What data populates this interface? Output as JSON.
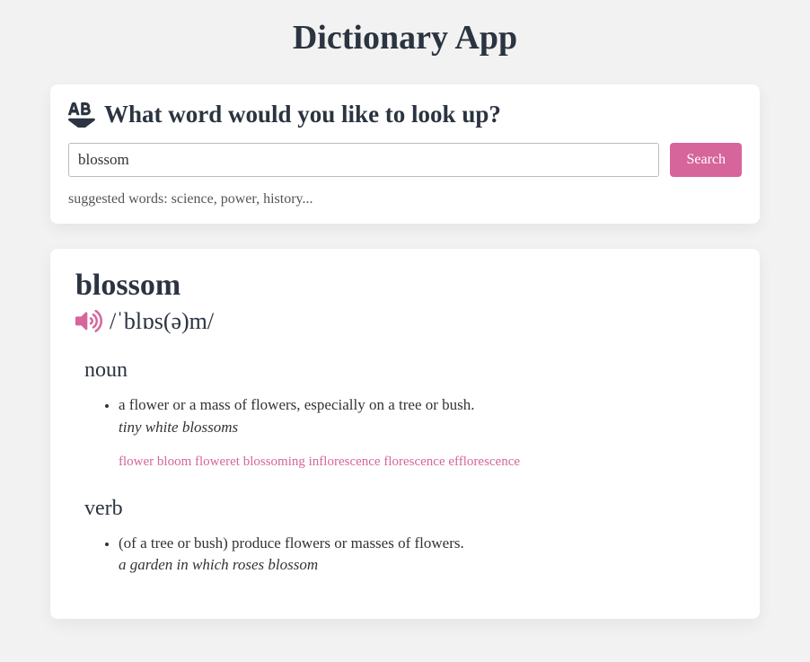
{
  "app": {
    "title": "Dictionary App"
  },
  "search": {
    "heading": "What word would you like to look up?",
    "input_value": "blossom",
    "button_label": "Search",
    "suggested_text": "suggested words: science, power, history..."
  },
  "result": {
    "word": "blossom",
    "phonetic": "/ˈblɒs(ə)m/",
    "meanings": [
      {
        "partOfSpeech": "noun",
        "definition": "a flower or a mass of flowers, especially on a tree or bush.",
        "example": "tiny white blossoms",
        "synonyms": "flower bloom floweret blossoming inflorescence florescence efflorescence"
      },
      {
        "partOfSpeech": "verb",
        "definition": "(of a tree or bush) produce flowers or masses of flowers.",
        "example": "a garden in which roses blossom"
      }
    ]
  }
}
